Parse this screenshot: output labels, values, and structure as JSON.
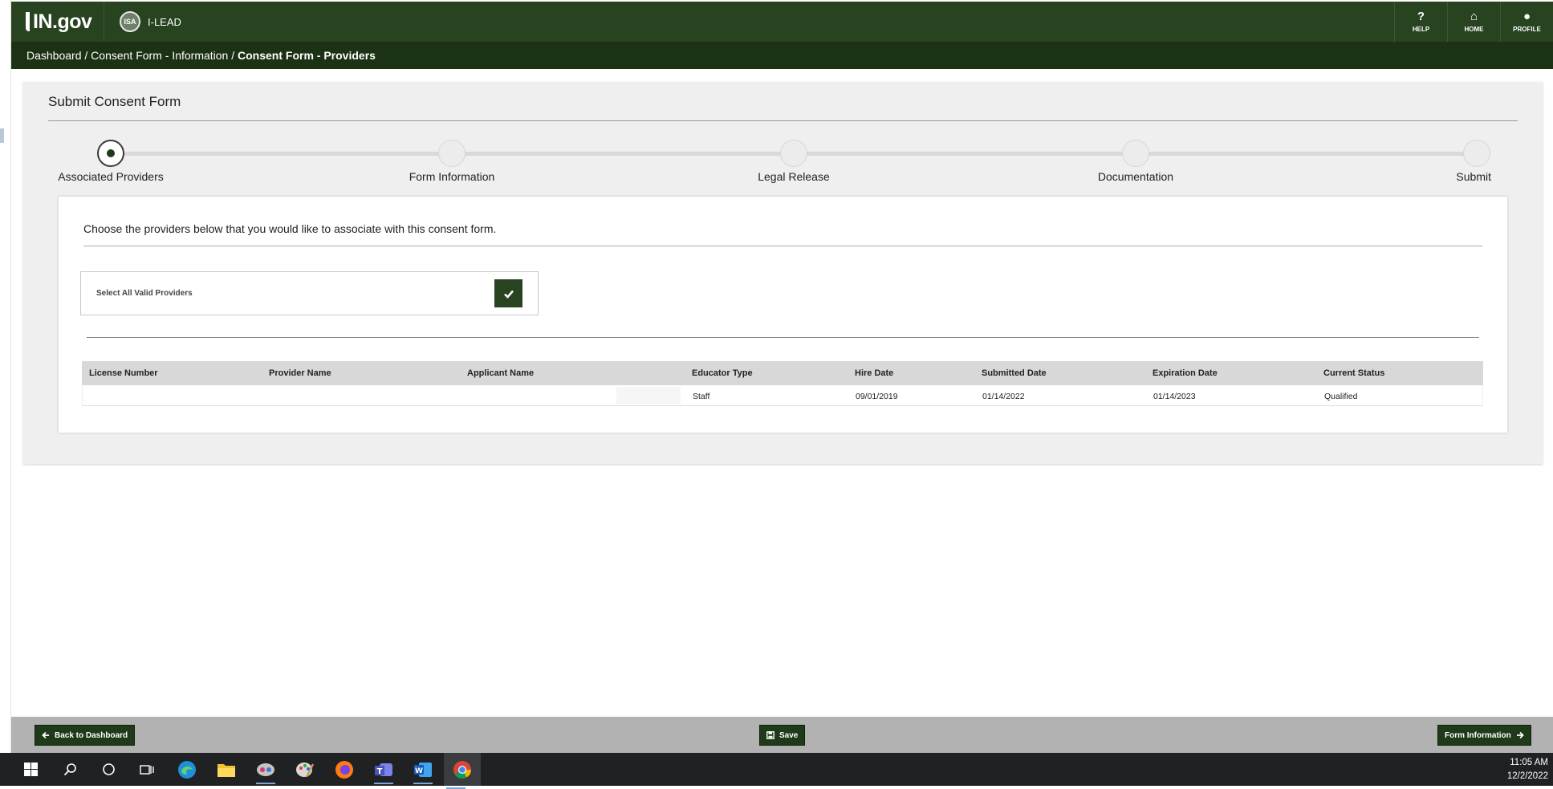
{
  "header": {
    "logo_text": "IN.gov",
    "app_name": "I-LEAD",
    "seal_text": "ISA",
    "nav": [
      {
        "label": "HELP",
        "icon": "help-circle-icon",
        "glyph": "?"
      },
      {
        "label": "HOME",
        "icon": "home-icon",
        "glyph": "⌂"
      },
      {
        "label": "PROFILE",
        "icon": "user-icon",
        "glyph": "●"
      }
    ]
  },
  "breadcrumb": {
    "items": [
      "Dashboard",
      "Consent Form - Information"
    ],
    "separator": " / ",
    "current": "Consent Form - Providers"
  },
  "panel": {
    "title": "Submit Consent Form"
  },
  "stepper": {
    "steps": [
      {
        "label": "Associated Providers",
        "active": true
      },
      {
        "label": "Form Information",
        "active": false
      },
      {
        "label": "Legal Release",
        "active": false
      },
      {
        "label": "Documentation",
        "active": false
      },
      {
        "label": "Submit",
        "active": false
      }
    ]
  },
  "card": {
    "intro": "Choose the providers below that you would like to associate with this consent form.",
    "select_all_label": "Select All Valid Providers",
    "select_all_checked": true
  },
  "grid": {
    "columns": [
      "License Number",
      "Provider Name",
      "Applicant Name",
      "Educator Type",
      "Hire Date",
      "Submitted Date",
      "Expiration Date",
      "Current Status"
    ],
    "rows": [
      {
        "license_number": "",
        "provider_name": "",
        "applicant_name": "",
        "educator_type": "Staff",
        "hire_date": "09/01/2019",
        "submitted_date": "01/14/2022",
        "expiration_date": "01/14/2023",
        "current_status": "Qualified"
      }
    ]
  },
  "footer": {
    "back_label": "Back to Dashboard",
    "save_label": "Save",
    "next_label": "Form Information"
  },
  "taskbar": {
    "time": "11:05 AM",
    "date": "12/2/2022"
  },
  "colors": {
    "header_green": "#27431f",
    "breadcrumb_green": "#1c3214",
    "button_green": "#1f3a18"
  }
}
